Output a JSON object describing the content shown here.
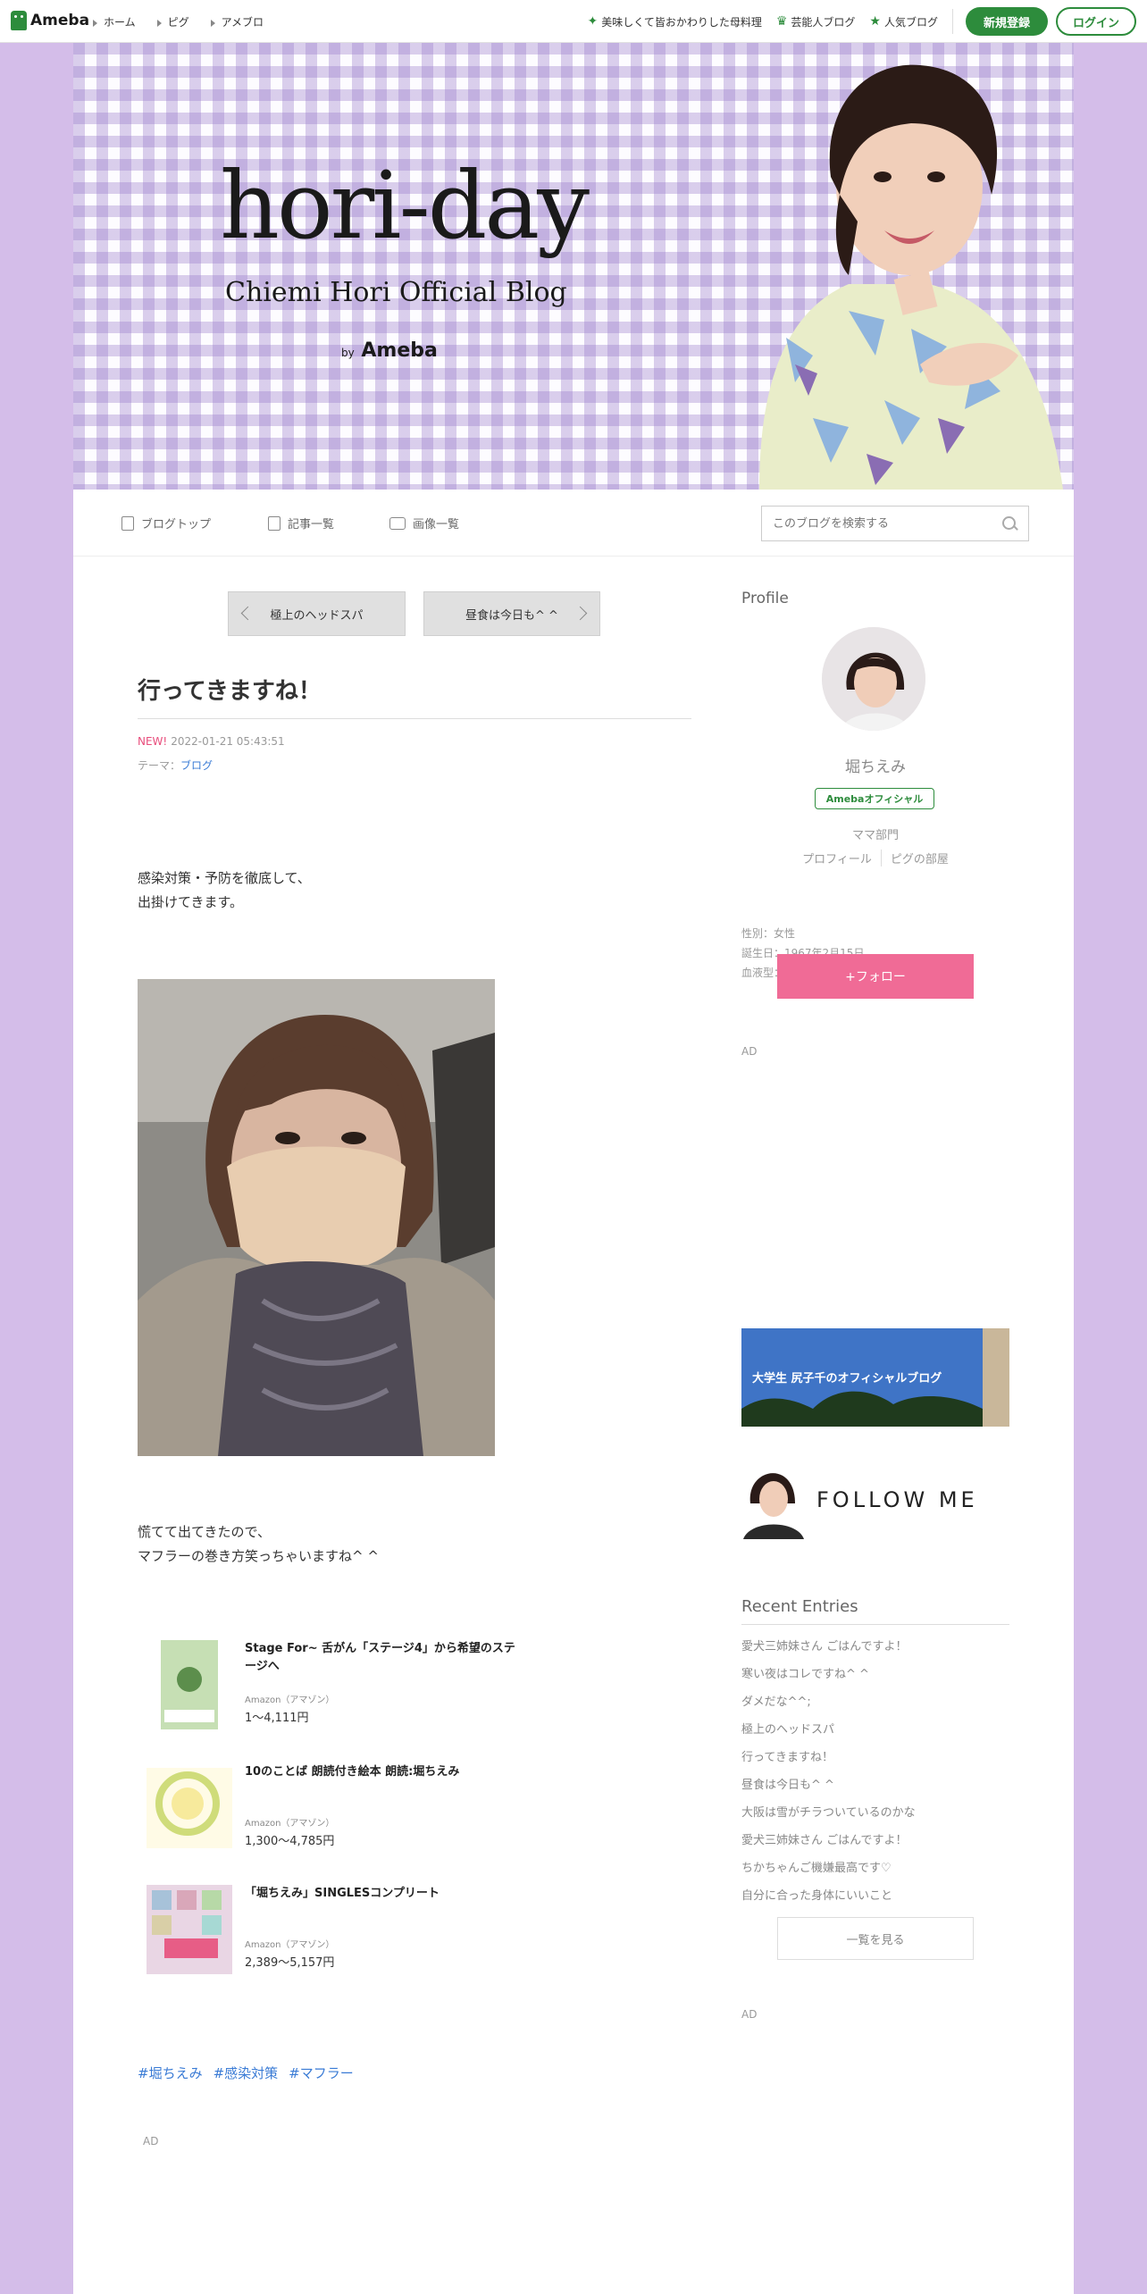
{
  "topbar": {
    "logo": "Ameba",
    "nav": [
      "ホーム",
      "ピグ",
      "アメブロ"
    ],
    "links": [
      {
        "label": "美味しくて皆おかわりした母料理",
        "icon": "sparkle-icon"
      },
      {
        "label": "芸能人ブログ",
        "icon": "crown-icon"
      },
      {
        "label": "人気ブログ",
        "icon": "star-icon"
      }
    ],
    "register": "新規登録",
    "login": "ログイン",
    "accent": "#2d8c3c"
  },
  "header": {
    "title": "hori-day",
    "subtitle": "Chiemi Hori Official Blog",
    "by": "by",
    "brand": "Ameba",
    "check_color": "#c9b8e4"
  },
  "blognav": {
    "top": "ブログトップ",
    "entries": "記事一覧",
    "images": "画像一覧",
    "search_placeholder": "このブログを検索する"
  },
  "pager": {
    "prev": "極上のヘッドスパ",
    "next": "昼食は今日も^ ^"
  },
  "entry": {
    "title": "行ってきますね！",
    "new_label": "NEW!",
    "date": "2022-01-21 05:43:51",
    "theme_label": "テーマ：",
    "theme": "ブログ",
    "text1": "感染対策・予防を徹底して、\n出掛けてきます。",
    "text2": "慌てて出てきたので、\nマフラーの巻き方笑っちゃいますね^ ^",
    "hashtags": [
      "#堀ちえみ",
      "#感染対策",
      "#マフラー"
    ],
    "ad": "AD"
  },
  "products": [
    {
      "title": "Stage For~ 舌がん「ステージ4」から希望のステージへ",
      "shop": "Amazon（アマゾン）",
      "price": "1〜4,111円"
    },
    {
      "title": "10のことば 朗読付き絵本 朗読:堀ちえみ",
      "shop": "Amazon（アマゾン）",
      "price": "1,300〜4,785円"
    },
    {
      "title": "「堀ちえみ」SINGLESコンプリート",
      "shop": "Amazon（アマゾン）",
      "price": "2,389〜5,157円"
    }
  ],
  "sidebar": {
    "profile_heading": "Profile",
    "name": "堀ちえみ",
    "badge": "Amebaオフィシャル",
    "category": "ママ部門",
    "links": [
      "プロフィール",
      "ピグの部屋"
    ],
    "gender": "性別：女性",
    "birthday": "誕生日：1967年2月15日",
    "blood": "血液型：B型",
    "follow": "+フォロー",
    "ad1": "AD",
    "banner1_text": "大学生 尻子千のオフィシャルブログ",
    "banner2_text": "FOLLOW ME",
    "recent_heading": "Recent Entries",
    "recent": [
      "愛犬三姉妹さん ごはんですよ！",
      "寒い夜はコレですね^ ^",
      "ダメだな^^;",
      "極上のヘッドスパ",
      "行ってきますね！",
      "昼食は今日も^ ^",
      "大阪は雪がチラついているのかな",
      "愛犬三姉妹さん ごはんですよ！",
      "ちかちゃんご機嫌最高です♡",
      "自分に合った身体にいいこと"
    ],
    "more": "一覧を見る",
    "ad2": "AD",
    "follow_color": "#f06b96"
  },
  "page": {
    "background": "#d4bde9"
  }
}
